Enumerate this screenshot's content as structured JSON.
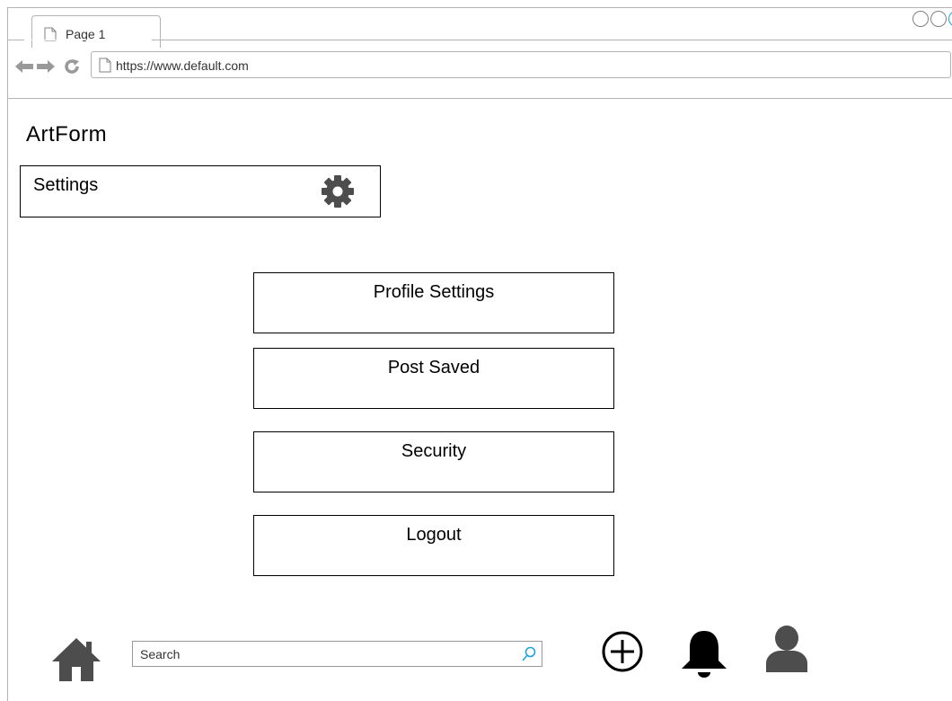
{
  "browser": {
    "tab_title": "Page 1",
    "url": "https://www.default.com"
  },
  "app": {
    "title": "ArtForm"
  },
  "settings_header": {
    "label": "Settings",
    "icon": "gear-icon"
  },
  "menu": {
    "items": [
      {
        "label": "Profile Settings"
      },
      {
        "label": "Post Saved"
      },
      {
        "label": "Security"
      },
      {
        "label": "Logout"
      }
    ]
  },
  "bottom_nav": {
    "search_placeholder": "Search",
    "icons": [
      "home-icon",
      "search-icon",
      "add-icon",
      "bell-icon",
      "user-icon"
    ]
  },
  "colors": {
    "icon_gray": "#4d4d4d",
    "border": "#000000",
    "chrome_border": "#b3b3b3",
    "accent_blue": "#1ba1e2"
  }
}
